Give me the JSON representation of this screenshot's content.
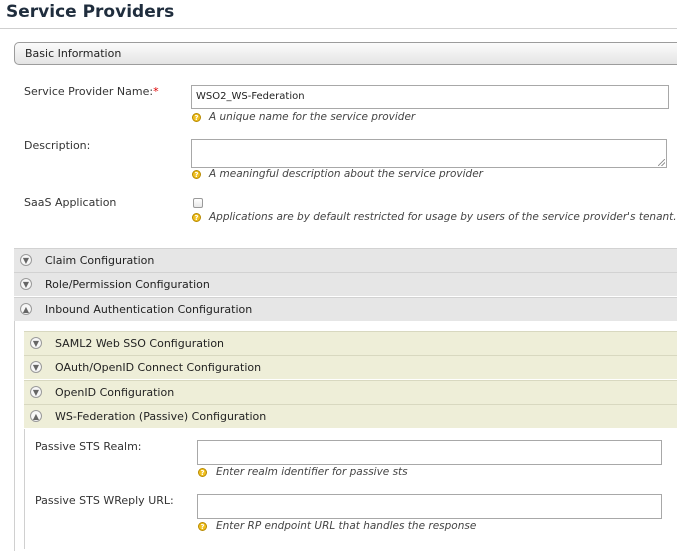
{
  "page": {
    "title": "Service Providers"
  },
  "basic_info": {
    "label": "Basic Information"
  },
  "form": {
    "sp_name": {
      "label": "Service Provider Name:",
      "required_mark": "*",
      "value": "WSO2_WS-Federation",
      "hint": "A unique name for the service provider"
    },
    "description": {
      "label": "Description:",
      "value": "",
      "hint": "A meaningful description about the service provider"
    },
    "saas": {
      "label": "SaaS Application",
      "checked": false,
      "hint": "Applications are by default restricted for usage by users of the service provider's tenant. If"
    }
  },
  "sections": [
    {
      "title": "Claim Configuration",
      "expanded": false
    },
    {
      "title": "Role/Permission Configuration",
      "expanded": false
    },
    {
      "title": "Inbound Authentication Configuration",
      "expanded": true
    }
  ],
  "inbound_subsections": [
    {
      "title": "SAML2 Web SSO Configuration",
      "expanded": false
    },
    {
      "title": "OAuth/OpenID Connect Configuration",
      "expanded": false
    },
    {
      "title": "OpenID Configuration",
      "expanded": false
    },
    {
      "title": "WS-Federation (Passive) Configuration",
      "expanded": true
    }
  ],
  "wsfed": {
    "realm": {
      "label": "Passive STS Realm:",
      "value": "",
      "hint": "Enter realm identifier for passive sts"
    },
    "wreply": {
      "label": "Passive STS WReply URL:",
      "value": "",
      "hint": "Enter RP endpoint URL that handles the response"
    }
  },
  "icons": {
    "help": "help-question-icon",
    "collapsed": "chevron-down-icon",
    "expanded": "chevron-up-icon"
  },
  "colors": {
    "required": "#dd0000",
    "help_icon": "#f0c020",
    "section_bg": "#e6e6e6",
    "subsection_bg": "#eeeed8"
  }
}
